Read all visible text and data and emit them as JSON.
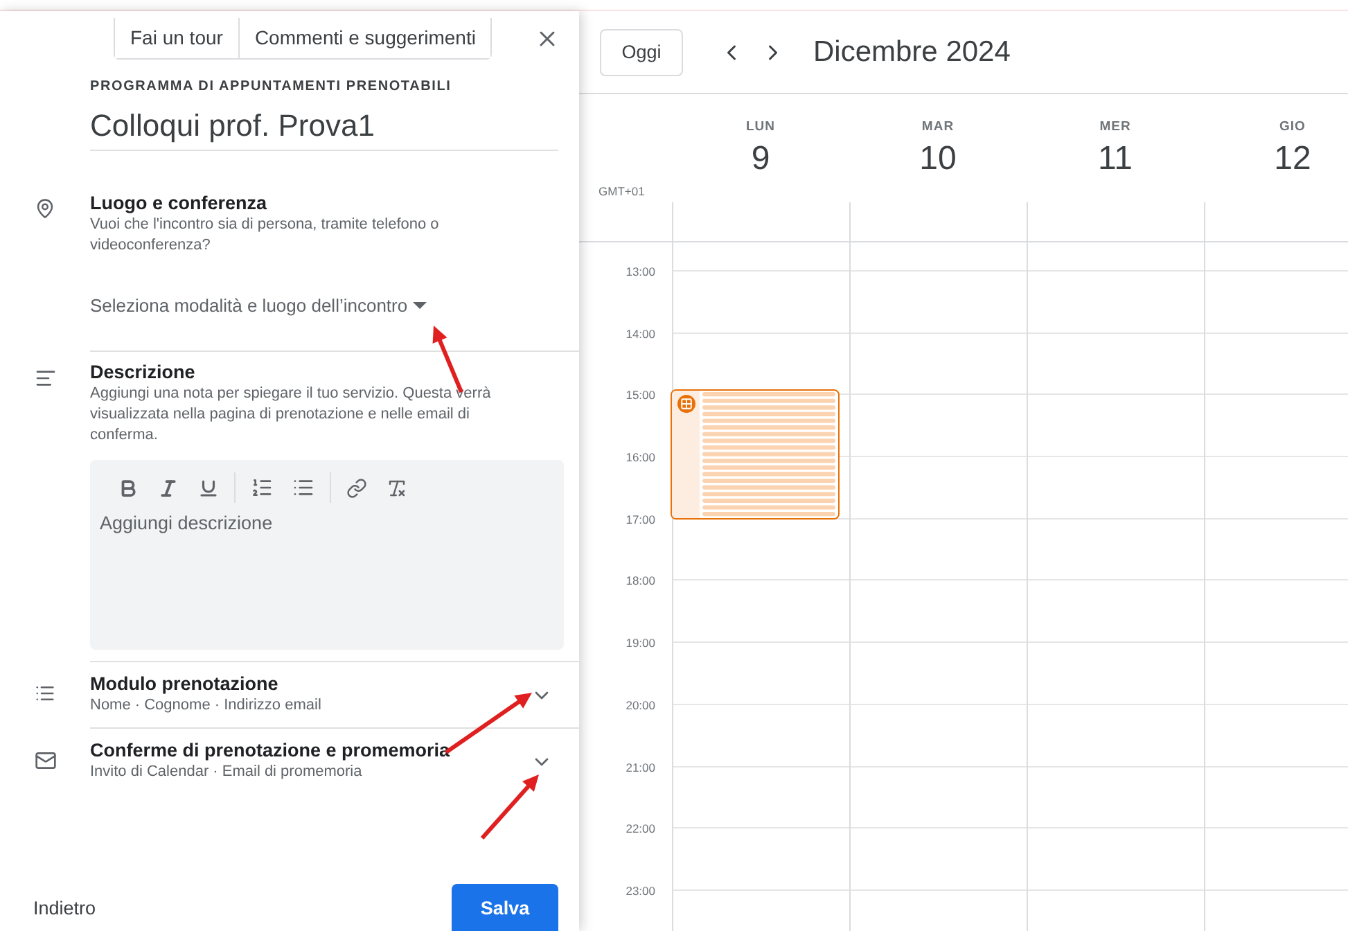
{
  "top_buttons": [
    "Fai un tour",
    "Commenti e suggerimenti"
  ],
  "panel": {
    "eyebrow": "PROGRAMMA DI APPUNTAMENTI PRENOTABILI",
    "title": "Colloqui prof. Prova1",
    "sections": [
      {
        "kind": "location",
        "title": "Luogo e conferenza",
        "description": "Vuoi che l'incontro sia di persona, tramite telefono o videoconferenza?",
        "dropdown": "Seleziona modalità e luogo dell’incontro"
      },
      {
        "kind": "description",
        "title": "Descrizione",
        "description": "Aggiungi una nota per spiegare il tuo servizio. Questa verrà visualizzata nella pagina di prenotazione e nelle email di conferma.",
        "placeholder": "Aggiungi descrizione"
      },
      {
        "kind": "form",
        "title": "Modulo prenotazione",
        "summary": "Nome · Cognome · Indirizzo email",
        "expanded": false
      },
      {
        "kind": "mail",
        "title": "Conferme di prenotazione e promemoria",
        "summary": "Invito di Calendar · Email di promemoria",
        "expanded": false
      }
    ],
    "back": "Indietro",
    "save": "Salva"
  },
  "calendar": {
    "today": "Oggi",
    "month": "Dicembre 2024",
    "timezone": "GMT+01",
    "days": [
      {
        "weekday": "LUN",
        "date": "9"
      },
      {
        "weekday": "MAR",
        "date": "10"
      },
      {
        "weekday": "MER",
        "date": "11"
      },
      {
        "weekday": "GIO",
        "date": "12"
      }
    ],
    "hours": [
      "13:00",
      "14:00",
      "15:00",
      "16:00",
      "17:00",
      "18:00",
      "19:00",
      "20:00",
      "21:00",
      "22:00",
      "23:00"
    ]
  }
}
